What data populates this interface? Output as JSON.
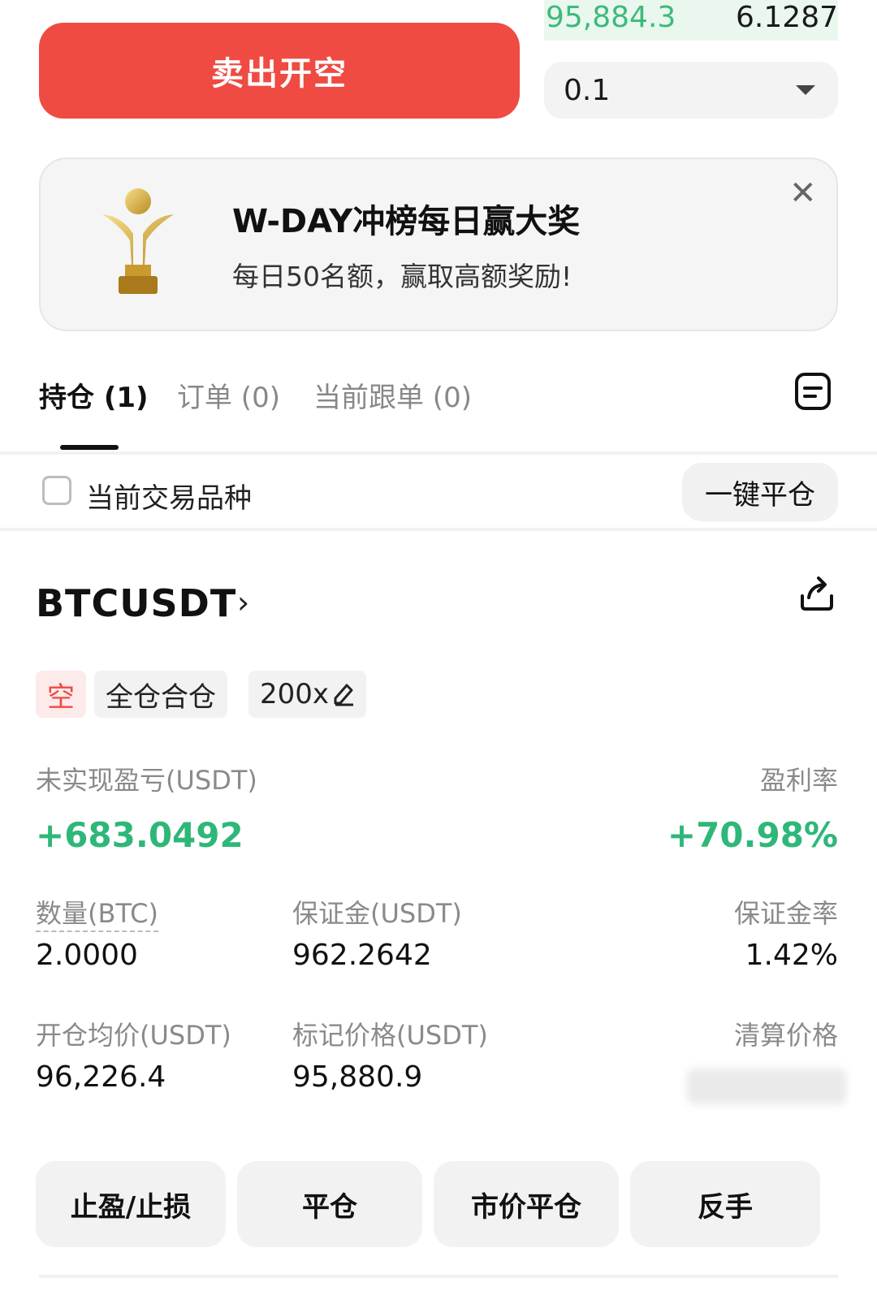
{
  "order_book": {
    "price": "95,884.3",
    "qty": "6.1287"
  },
  "trade": {
    "sell_button": "卖出开空",
    "qty_value": "0.1"
  },
  "banner": {
    "title": "W-DAY冲榜每日赢大奖",
    "subtitle": "每日50名额，赢取高额奖励!",
    "close": "✕"
  },
  "tabs": [
    {
      "label": "持仓 (1)"
    },
    {
      "label": "订单 (0)"
    },
    {
      "label": "当前跟单 (0)"
    }
  ],
  "filter": {
    "label": "当前交易品种",
    "close_all": "一键平仓"
  },
  "position": {
    "symbol": "BTCUSDT",
    "chevron": "›",
    "side": "空",
    "margin_mode": "全仓合仓",
    "leverage": "200x",
    "unrealized_pnl_label": "未实现盈亏(USDT)",
    "unrealized_pnl": "+683.0492",
    "roe_label": "盈利率",
    "roe": "+70.98%",
    "size_label": "数量(BTC)",
    "size": "2.0000",
    "margin_label": "保证金(USDT)",
    "margin": "962.2642",
    "margin_ratio_label": "保证金率",
    "margin_ratio": "1.42%",
    "entry_label": "开仓均价(USDT)",
    "entry": "96,226.4",
    "mark_label": "标记价格(USDT)",
    "mark": "95,880.9",
    "liq_label": "清算价格"
  },
  "actions": [
    "止盈/止损",
    "平仓",
    "市价平仓",
    "反手"
  ],
  "colors": {
    "sell": "#ef4b42",
    "profit": "#2fb779"
  }
}
